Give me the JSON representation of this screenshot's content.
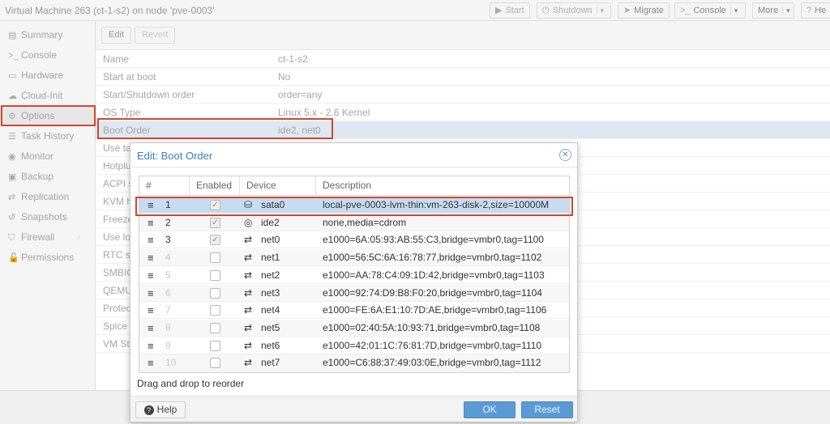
{
  "window": {
    "title": "Virtual Machine 263 (ct-1-s2) on node 'pve-0003'",
    "toolbar": [
      {
        "icon": "play-icon",
        "glyph": "▶",
        "label": "Start"
      },
      {
        "icon": "power-icon",
        "glyph": "⏻",
        "label": "Shutdown"
      },
      {
        "icon": "send-icon",
        "glyph": "➤",
        "label": "Migrate"
      },
      {
        "icon": "terminal-icon",
        "glyph": ">_",
        "label": "Console"
      },
      {
        "icon": "",
        "glyph": "",
        "label": "More"
      },
      {
        "icon": "help-icon",
        "glyph": "?",
        "label": "He"
      }
    ]
  },
  "sidebar": {
    "items": [
      {
        "label": "Summary",
        "icon": "book-icon",
        "glyph": "▤"
      },
      {
        "label": "Console",
        "icon": "terminal-icon",
        "glyph": ">_"
      },
      {
        "label": "Hardware",
        "icon": "monitor-icon",
        "glyph": "▭"
      },
      {
        "label": "Cloud-Init",
        "icon": "cloud-icon",
        "glyph": "☁"
      },
      {
        "label": "Options",
        "icon": "gear-icon",
        "glyph": "⚙"
      },
      {
        "label": "Task History",
        "icon": "list-icon",
        "glyph": "☰"
      },
      {
        "label": "Monitor",
        "icon": "eye-icon",
        "glyph": "◉"
      },
      {
        "label": "Backup",
        "icon": "floppy-icon",
        "glyph": "▣"
      },
      {
        "label": "Replication",
        "icon": "retweet-icon",
        "glyph": "⇄"
      },
      {
        "label": "Snapshots",
        "icon": "history-icon",
        "glyph": "↺"
      },
      {
        "label": "Firewall",
        "icon": "shield-icon",
        "glyph": "⛉"
      },
      {
        "label": "Permissions",
        "icon": "unlock-icon",
        "glyph": "🔓"
      }
    ],
    "active": "Options"
  },
  "main": {
    "edit_label": "Edit",
    "revert_label": "Revert",
    "options": [
      {
        "key": "Name",
        "value": "ct-1-s2"
      },
      {
        "key": "Start at boot",
        "value": "No"
      },
      {
        "key": "Start/Shutdown order",
        "value": "order=any"
      },
      {
        "key": "OS Type",
        "value": "Linux 5.x - 2.6 Kernel"
      },
      {
        "key": "Boot Order",
        "value": "ide2, net0"
      },
      {
        "key": "Use ta",
        "value": ""
      },
      {
        "key": "Hotplu",
        "value": ""
      },
      {
        "key": "ACPI s",
        "value": ""
      },
      {
        "key": "KVM h",
        "value": ""
      },
      {
        "key": "Freeze",
        "value": ""
      },
      {
        "key": "Use lo",
        "value": ""
      },
      {
        "key": "RTC st",
        "value": ""
      },
      {
        "key": "SMBIO",
        "value": ""
      },
      {
        "key": "QEMU",
        "value": ""
      },
      {
        "key": "Protec",
        "value": ""
      },
      {
        "key": "Spice",
        "value": ""
      },
      {
        "key": "VM St",
        "value": ""
      }
    ]
  },
  "dialog": {
    "title": "Edit: Boot Order",
    "columns": [
      "#",
      "Enabled",
      "Device",
      "Description"
    ],
    "rows": [
      {
        "num": "1",
        "enabled": true,
        "device": "sata0",
        "icon": "hdd-icon",
        "glyph": "⛁",
        "description": "local-pve-0003-lvm-thin:vm-263-disk-2,size=10000M"
      },
      {
        "num": "2",
        "enabled": true,
        "device": "ide2",
        "icon": "cdrom-icon",
        "glyph": "◎",
        "description": "none,media=cdrom"
      },
      {
        "num": "3",
        "enabled": true,
        "device": "net0",
        "icon": "exchange-icon",
        "glyph": "⇄",
        "description": "e1000=6A:05:93:AB:55:C3,bridge=vmbr0,tag=1100"
      },
      {
        "num": "4",
        "enabled": false,
        "device": "net1",
        "icon": "exchange-icon",
        "glyph": "⇄",
        "description": "e1000=56:5C:6A:16:78:77,bridge=vmbr0,tag=1102"
      },
      {
        "num": "5",
        "enabled": false,
        "device": "net2",
        "icon": "exchange-icon",
        "glyph": "⇄",
        "description": "e1000=AA:78:C4:09:1D:42,bridge=vmbr0,tag=1103"
      },
      {
        "num": "6",
        "enabled": false,
        "device": "net3",
        "icon": "exchange-icon",
        "glyph": "⇄",
        "description": "e1000=92:74:D9:B8:F0:20,bridge=vmbr0,tag=1104"
      },
      {
        "num": "7",
        "enabled": false,
        "device": "net4",
        "icon": "exchange-icon",
        "glyph": "⇄",
        "description": "e1000=FE:6A:E1:10:7D:AE,bridge=vmbr0,tag=1106"
      },
      {
        "num": "8",
        "enabled": false,
        "device": "net5",
        "icon": "exchange-icon",
        "glyph": "⇄",
        "description": "e1000=02:40:5A:10:93:71,bridge=vmbr0,tag=1108"
      },
      {
        "num": "9",
        "enabled": false,
        "device": "net6",
        "icon": "exchange-icon",
        "glyph": "⇄",
        "description": "e1000=42:01:1C:76:81:7D,bridge=vmbr0,tag=1110"
      },
      {
        "num": "10",
        "enabled": false,
        "device": "net7",
        "icon": "exchange-icon",
        "glyph": "⇄",
        "description": "e1000=C6:88:37:49:03:0E,bridge=vmbr0,tag=1112"
      }
    ],
    "hint": "Drag and drop to reorder",
    "help_label": "Help",
    "ok_label": "OK",
    "reset_label": "Reset"
  },
  "colors": {
    "highlight": "#d4462c",
    "accent": "#3a7fc1",
    "selected_row": "#c6dcf0",
    "primary_button": "#5b9bd5"
  }
}
